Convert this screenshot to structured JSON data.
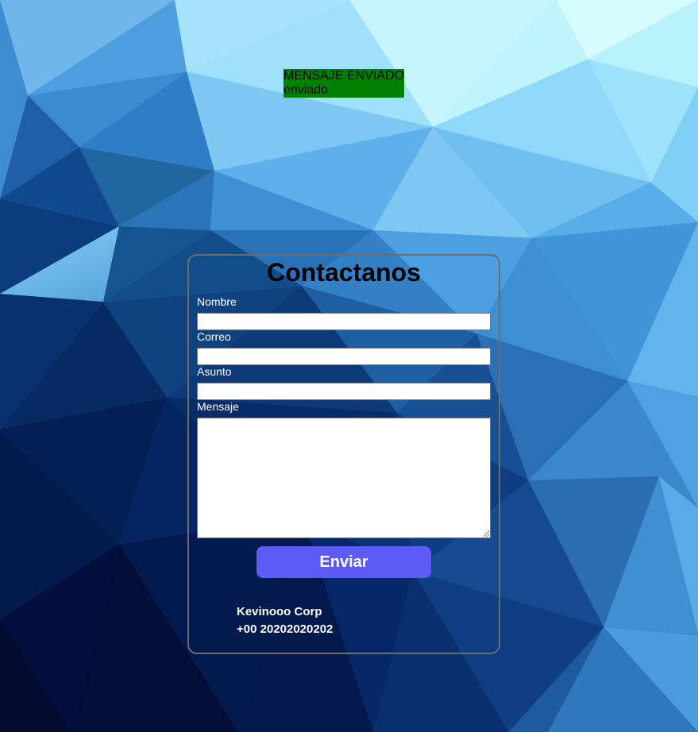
{
  "alert": {
    "line1": "MENSAJE ENVIADO",
    "line2": "enviado",
    "background_color": "#008000"
  },
  "contact_form": {
    "title": "Contactanos",
    "fields": {
      "nombre": {
        "label": "Nombre",
        "value": ""
      },
      "correo": {
        "label": "Correo",
        "value": ""
      },
      "asunto": {
        "label": "Asunto",
        "value": ""
      },
      "mensaje": {
        "label": "Mensaje",
        "value": ""
      }
    },
    "submit_label": "Enviar",
    "submit_color": "#5c5bf5"
  },
  "company": {
    "name": "Kevinooo Corp",
    "phone": "+00 20202020202"
  },
  "background": {
    "description_colors": [
      "#b9f0fb",
      "#7fc8f3",
      "#2f7fc2",
      "#0a3f7f",
      "#04154a"
    ]
  }
}
